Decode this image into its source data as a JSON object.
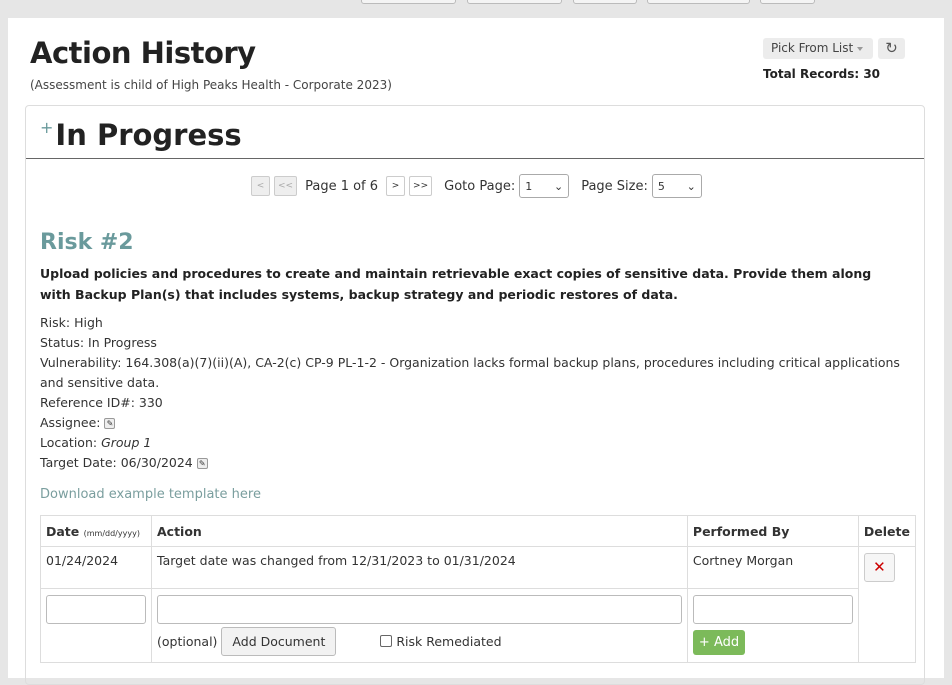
{
  "header": {
    "title": "Action History",
    "subtitle": "(Assessment is child of High Peaks Health - Corporate 2023)",
    "pick_label": "Pick From List",
    "total_records": "Total Records: 30"
  },
  "section": {
    "title": "In Progress"
  },
  "pager": {
    "prev": "<",
    "first": "<<",
    "page_text": "Page 1 of 6",
    "next": ">",
    "last": ">>",
    "goto_label": "Goto Page:",
    "goto_value": "1",
    "size_label": "Page Size:",
    "size_value": "5"
  },
  "risk": {
    "title": "Risk #2",
    "description": "Upload policies and procedures to create and maintain retrievable exact copies of sensitive data. Provide them along with Backup Plan(s) that includes systems, backup strategy and periodic restores of data.",
    "risk": "Risk: High",
    "status": "Status: In Progress",
    "vulnerability": "Vulnerability: 164.308(a)(7)(ii)(A), CA-2(c) CP-9 PL-1-2 - Organization lacks formal backup plans, procedures including critical applications and sensitive data.",
    "reference": "Reference ID#: 330",
    "assignee": "Assignee:",
    "location_label": "Location: ",
    "location_value": "Group 1",
    "target_date": "Target Date: 06/30/2024",
    "download_link": "Download example template here"
  },
  "table": {
    "headers": {
      "date": "Date",
      "date_fmt": "(mm/dd/yyyy)",
      "action": "Action",
      "performed_by": "Performed By",
      "delete": "Delete"
    },
    "rows": [
      {
        "date": "01/24/2024",
        "action": "Target date was changed from 12/31/2023 to 01/31/2024",
        "performed_by": "Cortney Morgan"
      }
    ],
    "new_row": {
      "optional": "(optional)",
      "add_document": "Add Document",
      "risk_remediated": "Risk Remediated",
      "add": "+ Add"
    }
  },
  "colors": {
    "accent": "#6a9a9c",
    "add_button": "#7cba5a",
    "delete_icon": "#cc0000"
  }
}
